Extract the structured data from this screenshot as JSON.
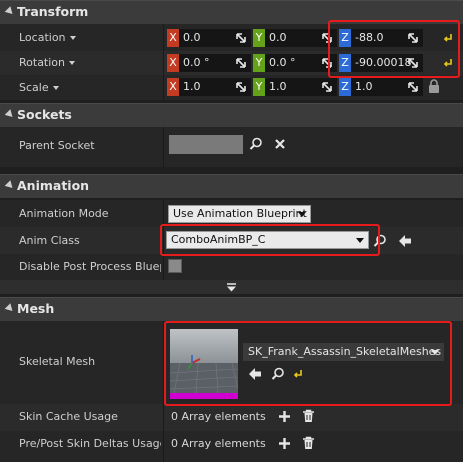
{
  "sections": {
    "transform": "Transform",
    "sockets": "Sockets",
    "animation": "Animation",
    "mesh": "Mesh"
  },
  "transform": {
    "location": {
      "label": "Location",
      "x": "0.0",
      "y": "0.0",
      "z": "-88.0"
    },
    "rotation": {
      "label": "Rotation",
      "x": "0.0 °",
      "y": "0.0 °",
      "z": "-90.00018"
    },
    "scale": {
      "label": "Scale",
      "x": "1.0",
      "y": "1.0",
      "z": "1.0"
    },
    "axis_labels": {
      "x": "X",
      "y": "Y",
      "z": "Z"
    }
  },
  "sockets": {
    "parent_socket_label": "Parent Socket",
    "parent_socket_value": ""
  },
  "animation": {
    "mode_label": "Animation Mode",
    "mode_value": "Use Animation Blueprint",
    "anim_class_label": "Anim Class",
    "anim_class_value": "ComboAnimBP_C",
    "disable_post_process_label": "Disable Post Process Blueprint",
    "disable_post_process_checked": false
  },
  "mesh": {
    "skeletal_mesh_label": "Skeletal Mesh",
    "skeletal_mesh_value": "SK_Frank_Assassin_SkeletalMeshes",
    "skin_cache_label": "Skin Cache Usage",
    "skin_cache_value": "0 Array elements",
    "deltas_label": "Pre/Post Skin Deltas Usage",
    "deltas_value": "0 Array elements"
  },
  "colors": {
    "axis_x": "#c23b22",
    "axis_y": "#64a21a",
    "axis_z": "#2c6bd6",
    "highlight": "#e61c1c",
    "thumbnail_bar": "#d000d0"
  }
}
